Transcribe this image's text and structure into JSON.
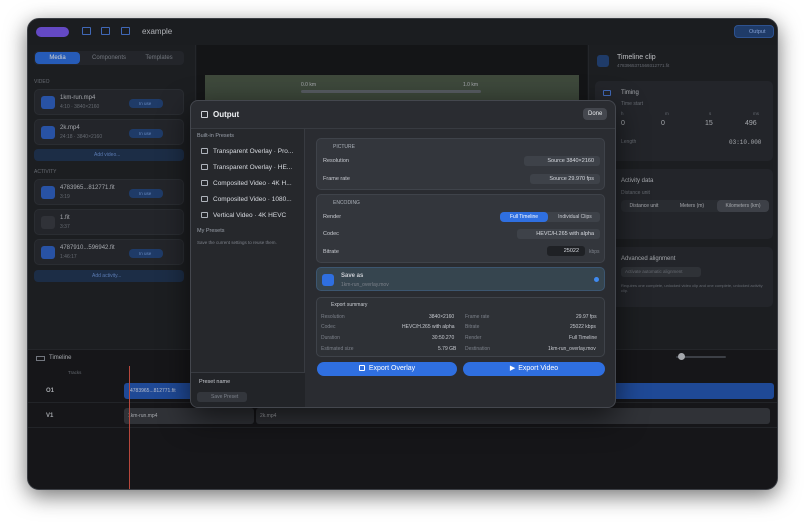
{
  "app": {
    "project_name": "example",
    "output_button": "Output"
  },
  "sidebar": {
    "tabs": [
      "Media",
      "Components",
      "Templates"
    ],
    "video_header": "VIDEO",
    "video_items": [
      {
        "name": "1km-run.mp4",
        "meta": "4:10 · 3840×2160",
        "badge": "In use"
      },
      {
        "name": "2k.mp4",
        "meta": "24:18 · 3840×2160",
        "badge": "In use"
      }
    ],
    "add_video": "Add video...",
    "activity_header": "ACTIVITY",
    "activity_items": [
      {
        "name": "4783965...812771.fit",
        "meta": "3:19",
        "badge": "In use"
      },
      {
        "name": "1.fit",
        "meta": "3:37",
        "badge": ""
      },
      {
        "name": "4787910...596942.fit",
        "meta": "1:46:17",
        "badge": "In use"
      }
    ],
    "add_activity": "Add activity..."
  },
  "preview": {
    "distance_left": "0.0 km",
    "distance_right": "1.0 km"
  },
  "inspector": {
    "title": "Timeline clip",
    "id": "4783965371569312771.fit",
    "timing_title": "Timing",
    "timing_sub": "Time start",
    "fields": [
      "h",
      "m",
      "s",
      "ms"
    ],
    "values": [
      "0",
      "0",
      "15",
      "496"
    ],
    "duration_label": "Length",
    "duration_value": "03:10.000",
    "activity_data_title": "Activity data",
    "activity_data_sub": "Distance unit",
    "units": [
      "Distance unit",
      "Meters (m)",
      "Kilometers (km)"
    ],
    "advanced_title": "Advanced alignment",
    "advanced_button": "Activate automatic alignment",
    "advanced_text": "Requires one complete, unlocked video clip and one complete, unlocked activity clip."
  },
  "timeline": {
    "title": "Timeline",
    "tracks_label": "Tracks",
    "tracks": [
      {
        "name": "O1",
        "clip": "4783965...812771.fit"
      },
      {
        "name": "V1",
        "clip": "1km-run.mp4",
        "clip2": "2k.mp4"
      }
    ]
  },
  "modal": {
    "title": "Output",
    "done": "Done",
    "builtin_header": "Built-in Presets",
    "presets": [
      "Transparent Overlay · Pro...",
      "Transparent Overlay · HE...",
      "Composited Video · 4K H...",
      "Composited Video · 1080...",
      "Vertical Video · 4K HEVC"
    ],
    "my_presets_header": "My Presets",
    "my_presets_hint": "Save the current settings to reuse them.",
    "preset_name_label": "Preset name",
    "save_preset": "Save Preset",
    "picture": {
      "header": "PICTURE",
      "resolution_label": "Resolution",
      "resolution_value": "Source 3840×2160",
      "framerate_label": "Frame rate",
      "framerate_value": "Source 29.970 fps"
    },
    "encoding": {
      "header": "ENCODING",
      "render_label": "Render",
      "render_options": [
        "Full Timeline",
        "Individual Clips"
      ],
      "codec_label": "Codec",
      "codec_value": "HEVC/H.265 with alpha",
      "bitrate_label": "Bitrate",
      "bitrate_value": "25022",
      "bitrate_unit": "kbps"
    },
    "save_as": {
      "label": "Save as",
      "filename": "1km-run_overlay.mov"
    },
    "summary": {
      "header": "Export summary",
      "rows": [
        {
          "l1": "Resolution",
          "v1": "3840×2160",
          "l2": "Frame rate",
          "v2": "29.97 fps"
        },
        {
          "l1": "Codec",
          "v1": "HEVC/H.265 with alpha",
          "l2": "Bitrate",
          "v2": "25022 kbps"
        },
        {
          "l1": "Duration",
          "v1": "30:50.270",
          "l2": "Render",
          "v2": "Full Timeline"
        },
        {
          "l1": "Estimated size",
          "v1": "5.79 GB",
          "l2": "Destination",
          "v2": "1km-run_overlay.mov"
        }
      ]
    },
    "export_overlay": "Export Overlay",
    "export_video": "Export Video"
  },
  "colors": {
    "accent": "#2f6fe0",
    "background": "#1d1f23"
  }
}
